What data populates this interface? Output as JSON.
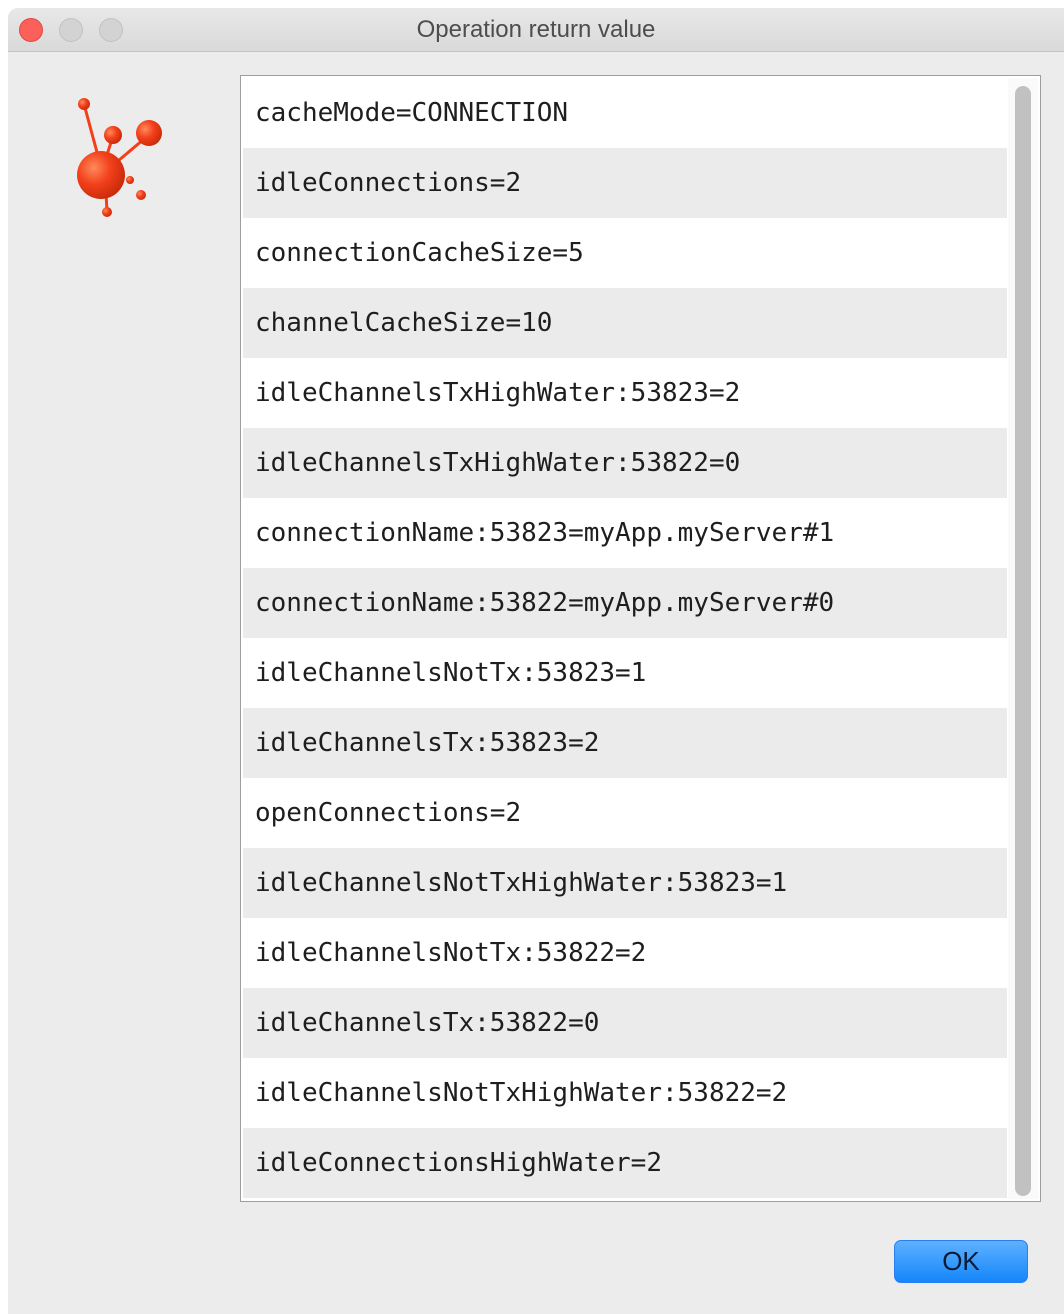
{
  "window": {
    "title": "Operation return value"
  },
  "list": {
    "rows": [
      "cacheMode=CONNECTION",
      "idleConnections=2",
      "connectionCacheSize=5",
      "channelCacheSize=10",
      "idleChannelsTxHighWater:53823=2",
      "idleChannelsTxHighWater:53822=0",
      "connectionName:53823=myApp.myServer#1",
      "connectionName:53822=myApp.myServer#0",
      "idleChannelsNotTx:53823=1",
      "idleChannelsTx:53823=2",
      "openConnections=2",
      "idleChannelsNotTxHighWater:53823=1",
      "idleChannelsNotTx:53822=2",
      "idleChannelsTx:53822=0",
      "idleChannelsNotTxHighWater:53822=2",
      "idleConnectionsHighWater=2"
    ]
  },
  "buttons": {
    "ok_label": "OK"
  },
  "colors": {
    "accent": "#1586fb",
    "logo": "#f2401b",
    "close": "#fc605b"
  },
  "icons": {
    "logo": "molecule-logo-icon"
  }
}
